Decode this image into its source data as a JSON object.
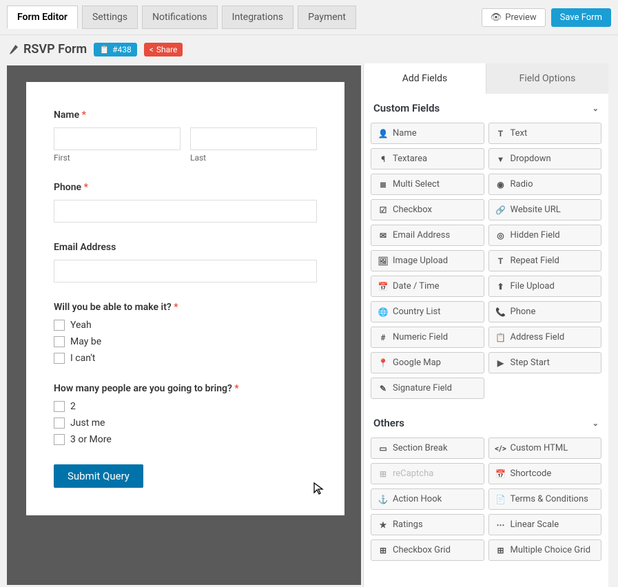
{
  "tabs": {
    "editor": "Form Editor",
    "settings": "Settings",
    "notifications": "Notifications",
    "integrations": "Integrations",
    "payment": "Payment"
  },
  "actions": {
    "preview": "Preview",
    "save": "Save Form"
  },
  "title": "RSVP Form",
  "id_chip": "#438",
  "share_chip": "Share",
  "form": {
    "name_label": "Name",
    "first_sub": "First",
    "last_sub": "Last",
    "phone_label": "Phone",
    "email_label": "Email Address",
    "q1_label": "Will you be able to make it?",
    "q1_opts": [
      "Yeah",
      "May be",
      "I can't"
    ],
    "q2_label": "How many people are you going to bring?",
    "q2_opts": [
      "2",
      "Just me",
      "3 or More"
    ],
    "submit": "Submit Query"
  },
  "right_tabs": {
    "add": "Add Fields",
    "opts": "Field Options"
  },
  "sections": {
    "custom": "Custom Fields",
    "others": "Others"
  },
  "custom_fields": [
    {
      "icon": "👤",
      "label": "Name"
    },
    {
      "icon": "T",
      "label": "Text"
    },
    {
      "icon": "¶",
      "label": "Textarea"
    },
    {
      "icon": "▾",
      "label": "Dropdown"
    },
    {
      "icon": "≣",
      "label": "Multi Select"
    },
    {
      "icon": "◉",
      "label": "Radio"
    },
    {
      "icon": "☑",
      "label": "Checkbox"
    },
    {
      "icon": "🔗",
      "label": "Website URL"
    },
    {
      "icon": "✉",
      "label": "Email Address"
    },
    {
      "icon": "◎",
      "label": "Hidden Field"
    },
    {
      "icon": "🖼",
      "label": "Image Upload"
    },
    {
      "icon": "T",
      "label": "Repeat Field"
    },
    {
      "icon": "📅",
      "label": "Date / Time"
    },
    {
      "icon": "⬆",
      "label": "File Upload"
    },
    {
      "icon": "🌐",
      "label": "Country List"
    },
    {
      "icon": "📞",
      "label": "Phone"
    },
    {
      "icon": "#",
      "label": "Numeric Field"
    },
    {
      "icon": "📋",
      "label": "Address Field"
    },
    {
      "icon": "📍",
      "label": "Google Map"
    },
    {
      "icon": "▶",
      "label": "Step Start"
    },
    {
      "icon": "✎",
      "label": "Signature Field"
    }
  ],
  "others_fields": [
    {
      "icon": "▭",
      "label": "Section Break"
    },
    {
      "icon": "</>",
      "label": "Custom HTML"
    },
    {
      "icon": "⊞",
      "label": "reCaptcha",
      "disabled": true
    },
    {
      "icon": "📅",
      "label": "Shortcode"
    },
    {
      "icon": "⚓",
      "label": "Action Hook"
    },
    {
      "icon": "📄",
      "label": "Terms & Conditions"
    },
    {
      "icon": "★",
      "label": "Ratings"
    },
    {
      "icon": "⋯",
      "label": "Linear Scale"
    },
    {
      "icon": "⊞",
      "label": "Checkbox Grid"
    },
    {
      "icon": "⊞",
      "label": "Multiple Choice Grid"
    }
  ]
}
